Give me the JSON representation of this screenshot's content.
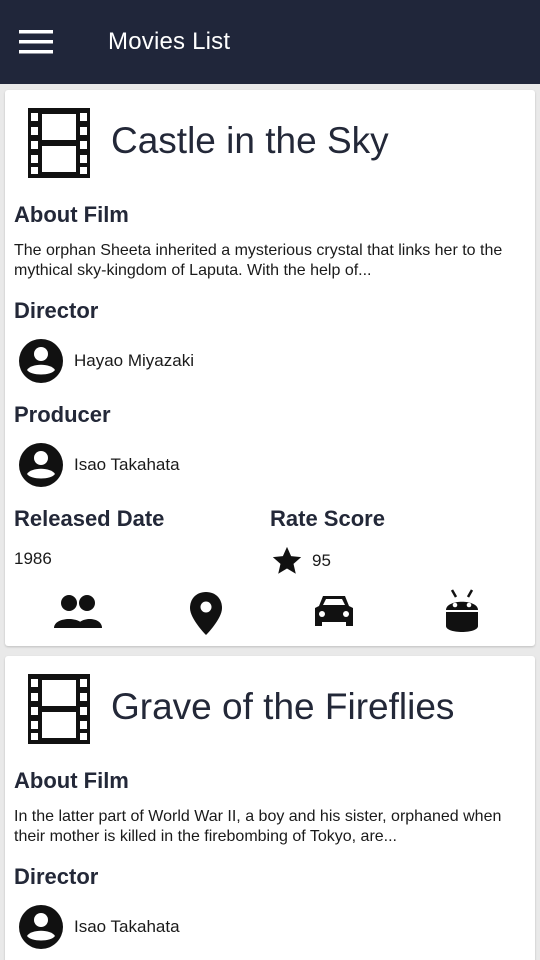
{
  "appbar": {
    "title": "Movies List",
    "menu_icon": "menu-icon",
    "background": "#20263a"
  },
  "movies": [
    {
      "title": "Castle in the Sky",
      "about_label": "About Film",
      "about_text": "The orphan Sheeta inherited a mysterious crystal that links her to the mythical sky-kingdom of Laputa. With the help of...",
      "director_label": "Director",
      "director": "Hayao Miyazaki",
      "producer_label": "Producer",
      "producer": "Isao Takahata",
      "released_label": "Released Date",
      "released": "1986",
      "rate_label": "Rate Score",
      "rate": "95",
      "actions": [
        "people-icon",
        "location-icon",
        "vehicle-icon",
        "android-icon"
      ]
    },
    {
      "title": "Grave of the Fireflies",
      "about_label": "About Film",
      "about_text": "In the latter part of World War II, a boy and his sister, orphaned when their mother is killed in the firebombing of Tokyo, are...",
      "director_label": "Director",
      "director": "Isao Takahata"
    }
  ]
}
